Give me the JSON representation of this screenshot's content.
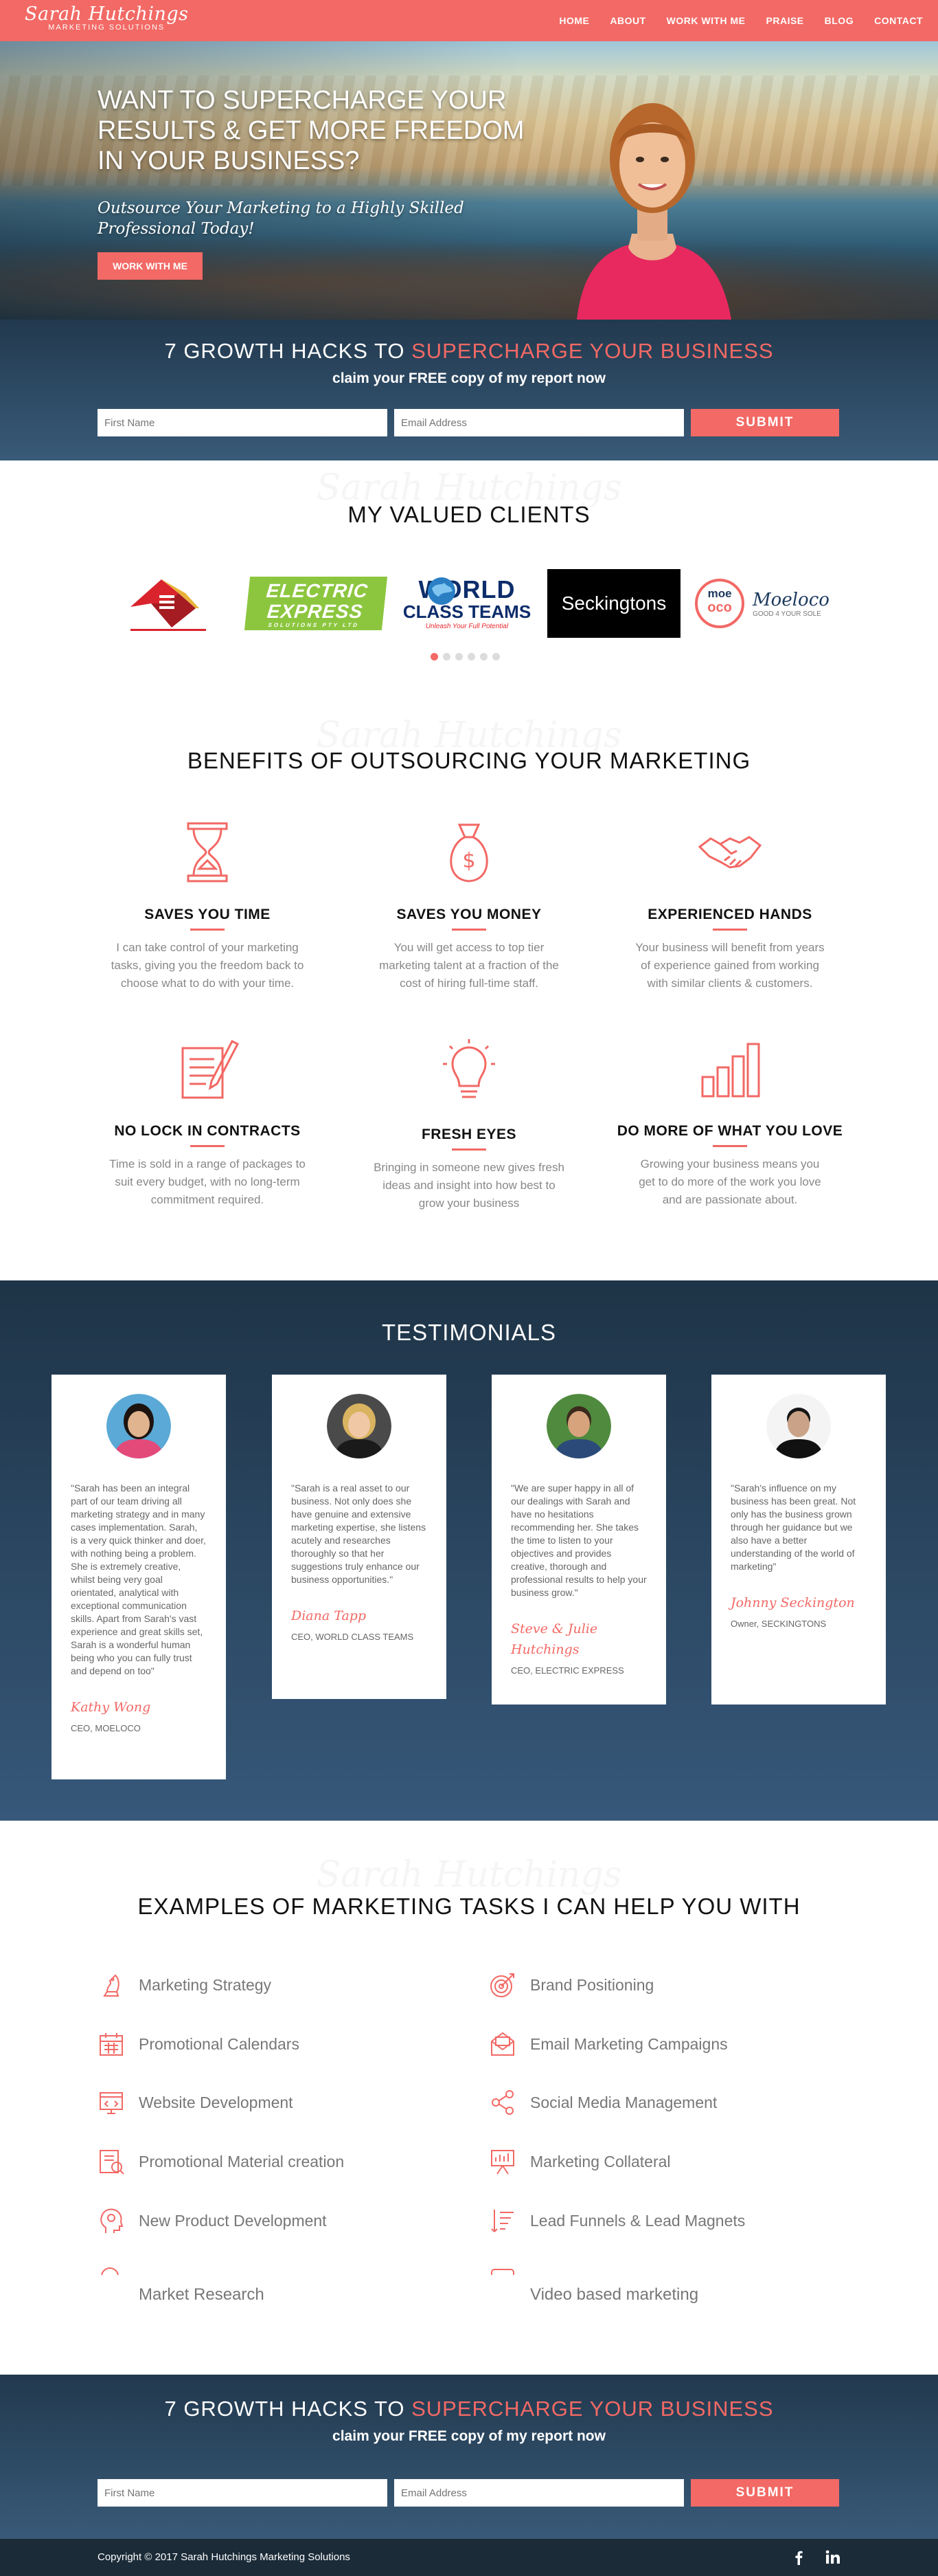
{
  "nav": {
    "logo_name": "Sarah Hutchings",
    "logo_sub": "MARKETING SOLUTIONS",
    "links": [
      "HOME",
      "ABOUT",
      "WORK WITH ME",
      "PRAISE",
      "BLOG",
      "CONTACT"
    ]
  },
  "hero": {
    "title": "WANT TO SUPERCHARGE YOUR RESULTS & GET MORE FREEDOM IN YOUR BUSINESS?",
    "subtitle": "Outsource Your Marketing to a Highly Skilled Professional Today!",
    "button": "WORK WITH ME"
  },
  "optin": {
    "title_plain": "7 GROWTH HACKS TO ",
    "title_highlight": "SUPERCHARGE YOUR BUSINESS",
    "subtitle": "claim your FREE copy of my report now",
    "first_name_placeholder": "First Name",
    "email_placeholder": "Email Address",
    "submit": "SUBMIT"
  },
  "clients": {
    "watermark": "Sarah Hutchings",
    "title": "MY VALUED CLIENTS",
    "logos": [
      {
        "name": "ebs-logo-icon"
      },
      {
        "line1": "ELECTRIC",
        "line2": "EXPRESS",
        "line3": "SOLUTIONS PTY LTD"
      },
      {
        "line1": "WORLD",
        "line2": "CLASS TEAMS",
        "line3": "Unleash Your Full Potential"
      },
      {
        "text": "Seckingtons"
      },
      {
        "badge1": "moe",
        "badge2": "oco",
        "text": "Moeloco",
        "sub": "GOOD 4 YOUR SOLE"
      }
    ],
    "dots": 6,
    "active_dot": 0
  },
  "benefits": {
    "watermark": "Sarah Hutchings",
    "title": "BENEFITS OF OUTSOURCING YOUR MARKETING",
    "items": [
      {
        "icon": "hourglass-icon",
        "title": "SAVES YOU TIME",
        "text": "I can take control of your marketing tasks, giving you the freedom back to choose what to do with your time."
      },
      {
        "icon": "money-bag-icon",
        "title": "SAVES YOU MONEY",
        "text": "You will get access to top tier marketing talent at a fraction of the cost of hiring full-time staff."
      },
      {
        "icon": "handshake-icon",
        "title": "EXPERIENCED HANDS",
        "text": "Your business will benefit from years of experience gained from working with similar clients & customers."
      },
      {
        "icon": "contract-icon",
        "title": "NO LOCK IN CONTRACTS",
        "text": "Time is sold in a range of packages to suit every budget, with no long-term commitment required."
      },
      {
        "icon": "lightbulb-icon",
        "title": "FRESH EYES",
        "text": "Bringing in someone new gives fresh ideas and insight into how best to grow your business"
      },
      {
        "icon": "bar-chart-icon",
        "title": "DO MORE OF WHAT YOU LOVE",
        "text": "Growing your business means you get to do more of the work you love and are passionate about."
      }
    ]
  },
  "testimonials": {
    "title": "TESTIMONIALS",
    "items": [
      {
        "quote": "\"Sarah has been an integral part of our team driving all marketing strategy and in many cases implementation. Sarah, is a very quick thinker and doer, with nothing being a problem. She is extremely creative, whilst being very goal orientated, analytical with exceptional communication skills. Apart from Sarah's vast experience and great skills set, Sarah is a wonderful human being who you can fully trust and depend on too\"",
        "name": "Kathy Wong",
        "role": "CEO, MOELOCO",
        "colors": {
          "bg": "#5aa9d6",
          "skin": "#e0b48f",
          "hair": "#1d1410",
          "shirt": "#e34a7a"
        }
      },
      {
        "quote": "\"Sarah is a real asset to our business. Not only does she have genuine and extensive marketing expertise, she listens acutely and researches thoroughly so that her suggestions truly enhance our business opportunities.\"",
        "name": "Diana Tapp",
        "role": "CEO, WORLD CLASS TEAMS",
        "colors": {
          "bg": "#4a4a4a",
          "skin": "#f0c8a6",
          "hair": "#d9b35f",
          "shirt": "#1a1a1a"
        }
      },
      {
        "quote": "\"We are super happy in all of our dealings with Sarah and have no hesitations recommending her. She takes the time to listen to your objectives and provides creative, thorough and professional results to help your business grow.\"",
        "name": "Steve & Julie Hutchings",
        "role": "CEO, ELECTRIC EXPRESS",
        "colors": {
          "bg": "#4f8a3e",
          "skin": "#d7a37c",
          "hair": "#3b2a1c",
          "shirt": "#2b4a7a"
        }
      },
      {
        "quote": "\"Sarah's influence on my business has been great. Not only has the business grown through her guidance but we also have a better understanding of the world of marketing\"",
        "name": "Johnny Seckington",
        "role": "Owner, SECKINGTONS",
        "colors": {
          "bg": "#f4f4f4",
          "skin": "#caa287",
          "hair": "#151515",
          "shirt": "#111111"
        }
      }
    ]
  },
  "tasks": {
    "watermark": "Sarah Hutchings",
    "title": "EXAMPLES OF MARKETING TASKS I CAN HELP YOU WITH",
    "left": [
      {
        "icon": "chess-knight-icon",
        "label": "Marketing Strategy"
      },
      {
        "icon": "calendar-icon",
        "label": "Promotional Calendars"
      },
      {
        "icon": "code-window-icon",
        "label": "Website Development"
      },
      {
        "icon": "brochure-icon",
        "label": "Promotional Material creation"
      },
      {
        "icon": "head-gear-icon",
        "label": "New Product Development"
      }
    ],
    "right": [
      {
        "icon": "target-icon",
        "label": "Brand Positioning"
      },
      {
        "icon": "envelope-icon",
        "label": "Email Marketing Campaigns"
      },
      {
        "icon": "share-icon",
        "label": "Social Media Management"
      },
      {
        "icon": "presentation-icon",
        "label": "Marketing Collateral"
      },
      {
        "icon": "funnel-list-icon",
        "label": "Lead Funnels & Lead Magnets"
      }
    ],
    "overflow_left": "Market Research",
    "overflow_right": "Video based marketing"
  },
  "footer": {
    "copyright": "Copyright © 2017 Sarah Hutchings Marketing Solutions",
    "social": [
      "facebook-icon",
      "linkedin-icon"
    ]
  },
  "colors": {
    "accent": "#f26965",
    "navy": "#22394e",
    "footer": "#1b2b38"
  }
}
